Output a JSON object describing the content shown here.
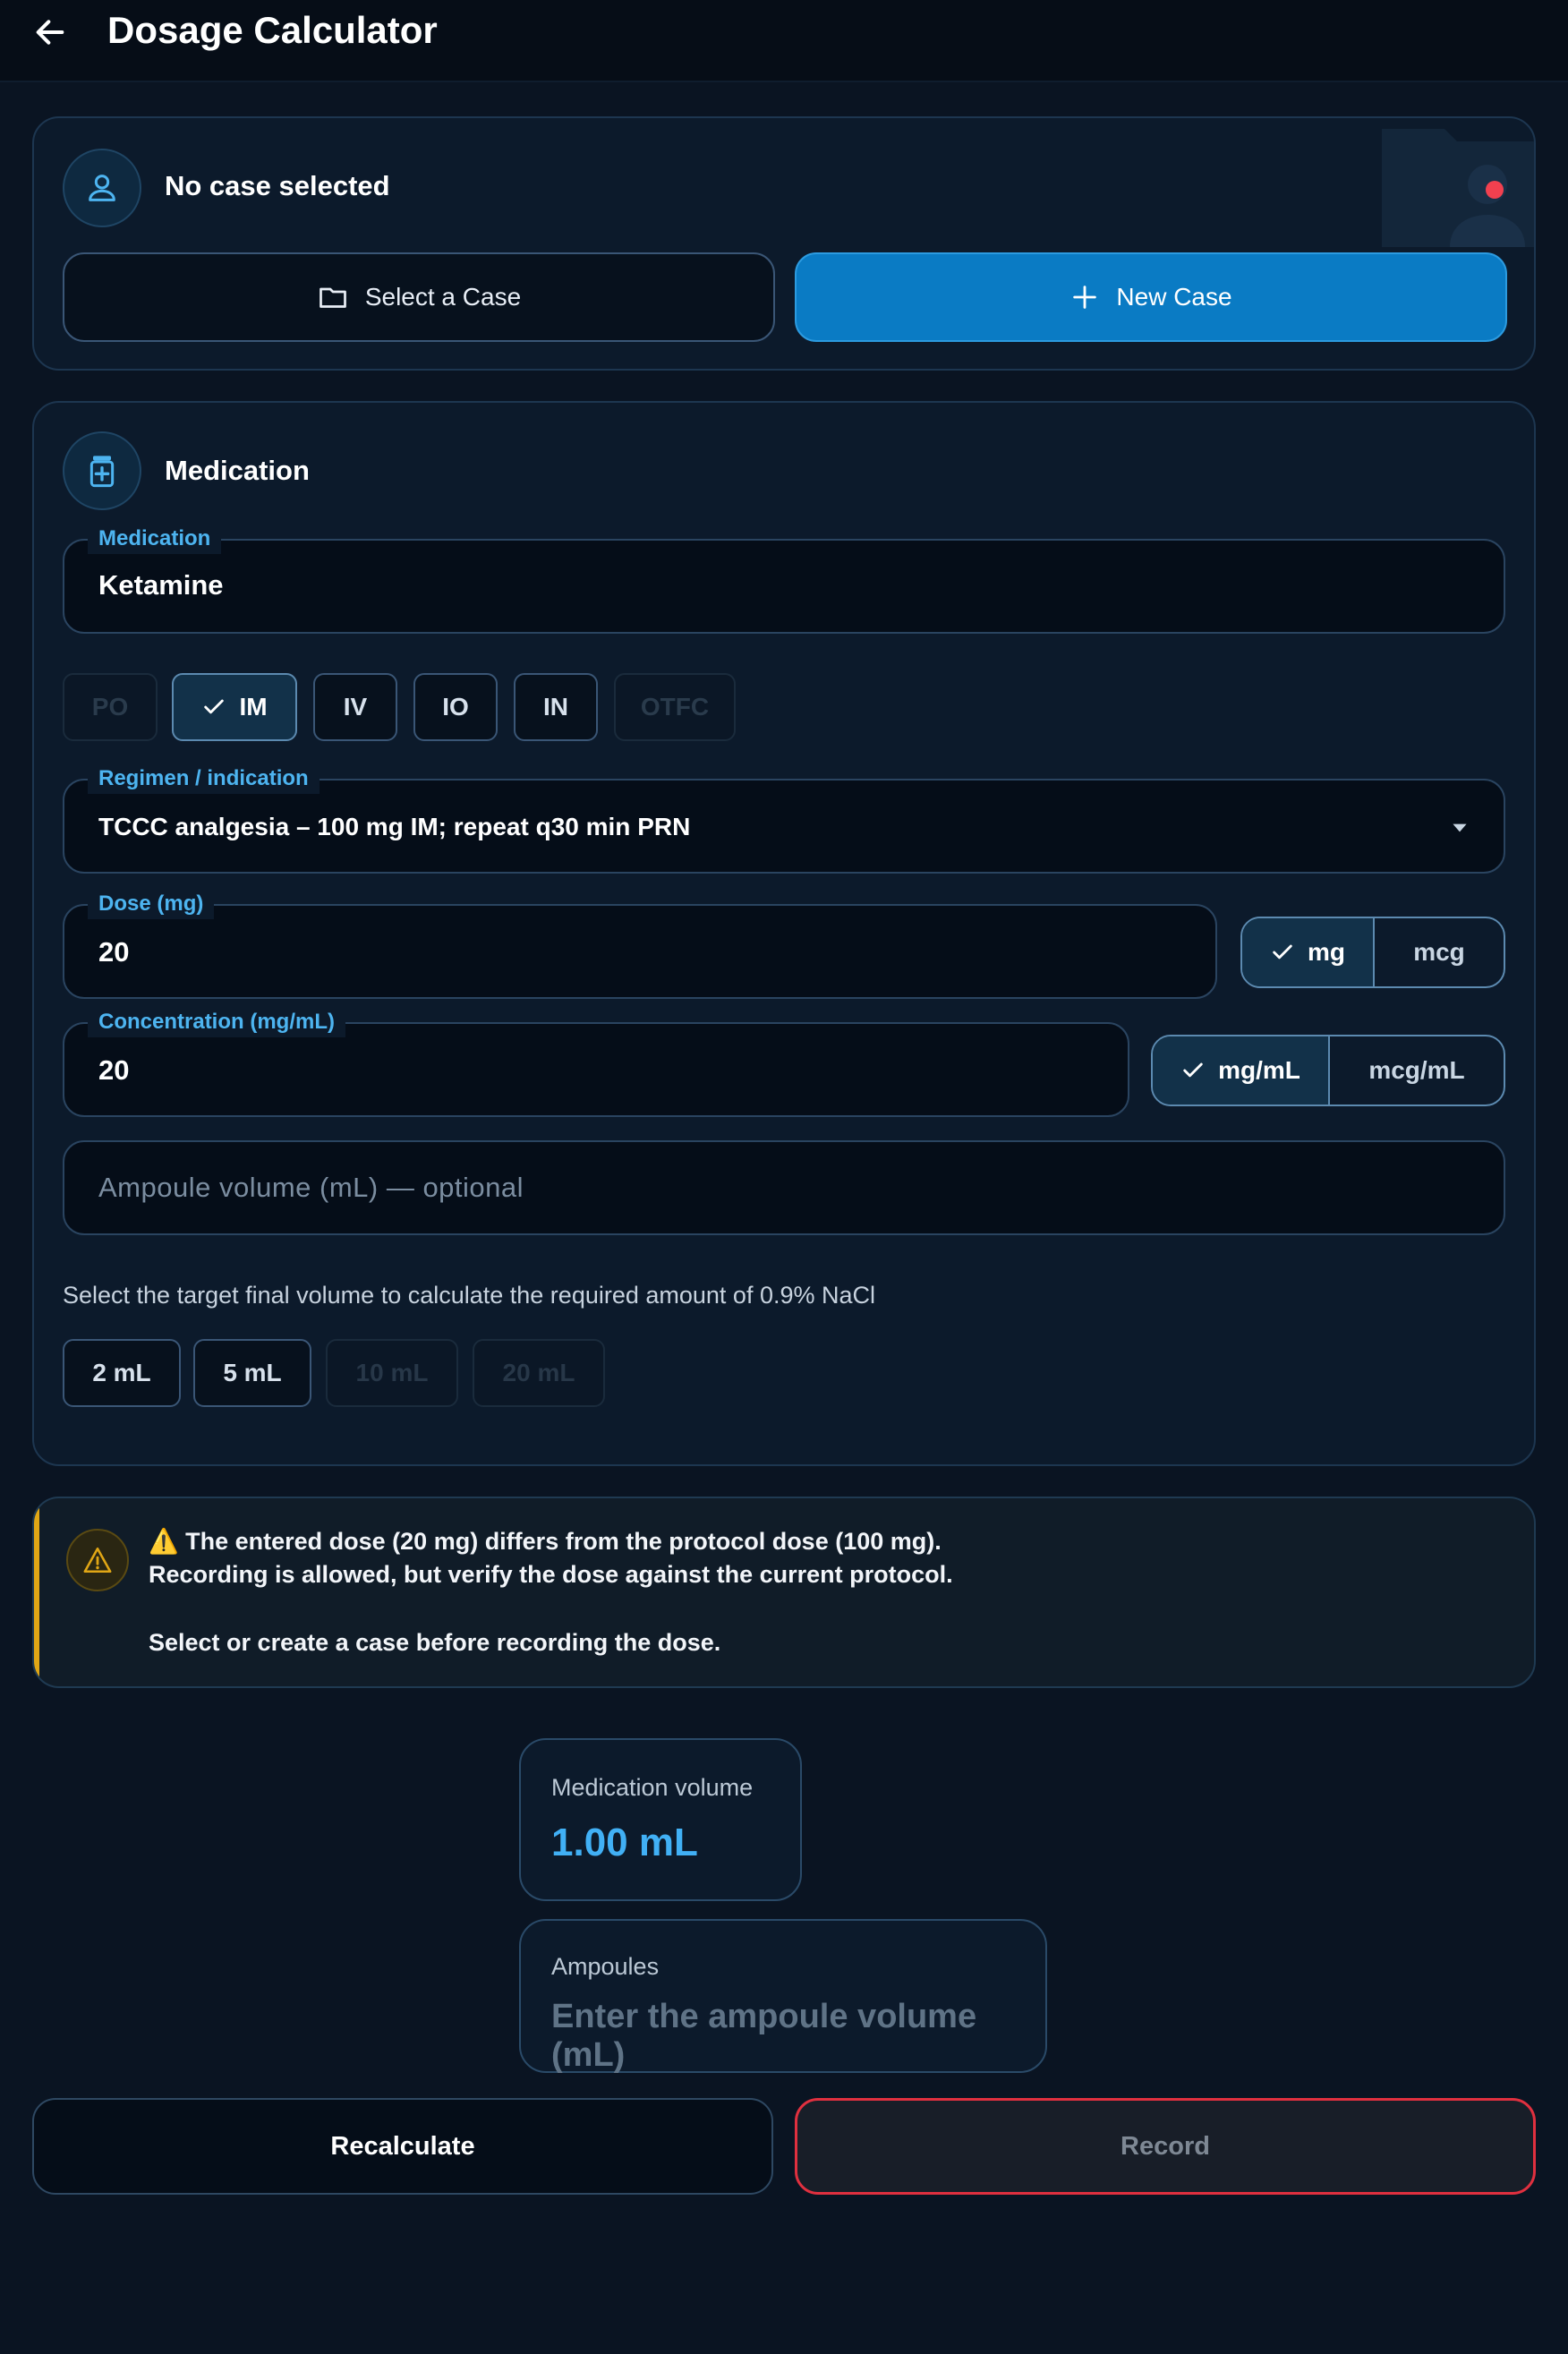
{
  "header": {
    "title": "Dosage Calculator"
  },
  "case": {
    "status": "No case selected",
    "select_label": "Select a Case",
    "new_label": "New Case"
  },
  "medication": {
    "heading": "Medication",
    "field_label": "Medication",
    "field_value": "Ketamine",
    "routes": [
      {
        "label": "PO",
        "state": "disabled"
      },
      {
        "label": "IM",
        "state": "selected"
      },
      {
        "label": "IV",
        "state": "enabled"
      },
      {
        "label": "IO",
        "state": "enabled"
      },
      {
        "label": "IN",
        "state": "enabled"
      },
      {
        "label": "OTFC",
        "state": "disabled"
      }
    ],
    "regimen_label": "Regimen / indication",
    "regimen_value": "TCCC analgesia – 100 mg IM; repeat q30 min PRN",
    "dose_label": "Dose (mg)",
    "dose_value": "20",
    "dose_units": [
      "mg",
      "mcg"
    ],
    "dose_unit_selected": "mg",
    "conc_label": "Concentration (mg/mL)",
    "conc_value": "20",
    "conc_units": [
      "mg/mL",
      "mcg/mL"
    ],
    "conc_unit_selected": "mg/mL",
    "ampoule_placeholder": "Ampoule volume (mL) — optional",
    "target_hint": "Select the target final volume to calculate the required amount of 0.9% NaCl",
    "volumes": [
      {
        "label": "2 mL",
        "state": "enabled"
      },
      {
        "label": "5 mL",
        "state": "enabled"
      },
      {
        "label": "10 mL",
        "state": "disabled"
      },
      {
        "label": "20 mL",
        "state": "disabled"
      }
    ]
  },
  "warning": {
    "line1": "⚠️ The entered dose (20 mg) differs from the protocol dose (100 mg).",
    "line2": "Recording is allowed, but verify the dose against the current protocol.",
    "line3": "Select or create a case before recording the dose."
  },
  "results": {
    "med_volume_label": "Medication volume",
    "med_volume_value": "1.00 mL",
    "ampoules_label": "Ampoules",
    "ampoules_hint": "Enter the ampoule volume (mL)"
  },
  "actions": {
    "recalculate": "Recalculate",
    "record": "Record"
  },
  "colors": {
    "accent": "#41b0f5",
    "primary": "#0a7bc4",
    "warning": "#e0a615",
    "danger": "#e0303f"
  }
}
